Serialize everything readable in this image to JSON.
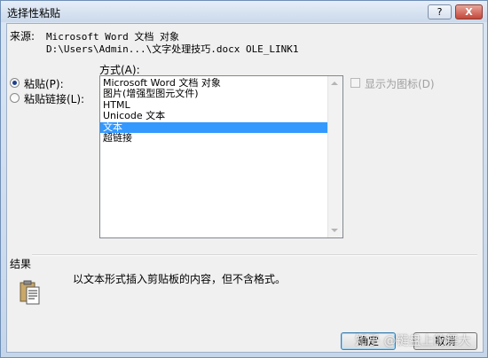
{
  "window": {
    "title": "选择性粘贴",
    "help_label": "?",
    "close_label": "X"
  },
  "source": {
    "label": "来源:",
    "line1": "Microsoft Word 文档 对象",
    "line2": "D:\\Users\\Admin...\\文字处理技巧.docx OLE_LINK1"
  },
  "paste_options": {
    "paste_label": "粘贴(P):",
    "paste_selected": true,
    "paste_link_label": "粘贴链接(L):",
    "paste_link_selected": false
  },
  "as_list": {
    "label": "方式(A):",
    "items": [
      "Microsoft Word 文档 对象",
      "图片(增强型图元文件)",
      "HTML",
      "Unicode 文本",
      "文本",
      "超链接"
    ],
    "selected_index": 4
  },
  "display_as_icon": {
    "label": "显示为图标(D)",
    "checked": false,
    "enabled": false
  },
  "result": {
    "label": "结果",
    "text": "以文本形式插入剪贴板的内容，但不含格式。"
  },
  "buttons": {
    "ok_label": "确定",
    "cancel_label": "取消"
  },
  "watermark": "知乎 @键盘上的舞大",
  "colors": {
    "selection": "#3399ff",
    "radio_dot": "#1e3f8f"
  }
}
